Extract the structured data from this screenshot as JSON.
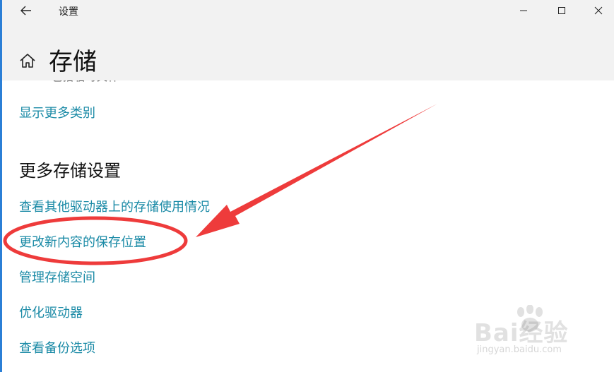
{
  "window": {
    "app_title": "设置",
    "page_title": "存储",
    "accent_color": "#2b7fd6"
  },
  "controls": {
    "back_icon": "back-arrow-icon",
    "home_icon": "home-icon",
    "minimize_icon": "minimize-icon",
    "maximize_icon": "maximize-icon",
    "close_icon": "close-icon"
  },
  "content": {
    "clipped_text": "包括临时文件",
    "show_more_link": "显示更多类别",
    "section_heading": "更多存储设置",
    "links": [
      "查看其他驱动器上的存储使用情况",
      "更改新内容的保存位置",
      "管理存储空间",
      "优化驱动器",
      "查看备份选项"
    ],
    "link_color": "#1a8aa6"
  },
  "annotation": {
    "color": "#ee3b3b",
    "highlighted_item": "更改新内容的保存位置"
  },
  "watermark": {
    "brand": "Bai经验",
    "url": "jingyan.baidu.com"
  }
}
